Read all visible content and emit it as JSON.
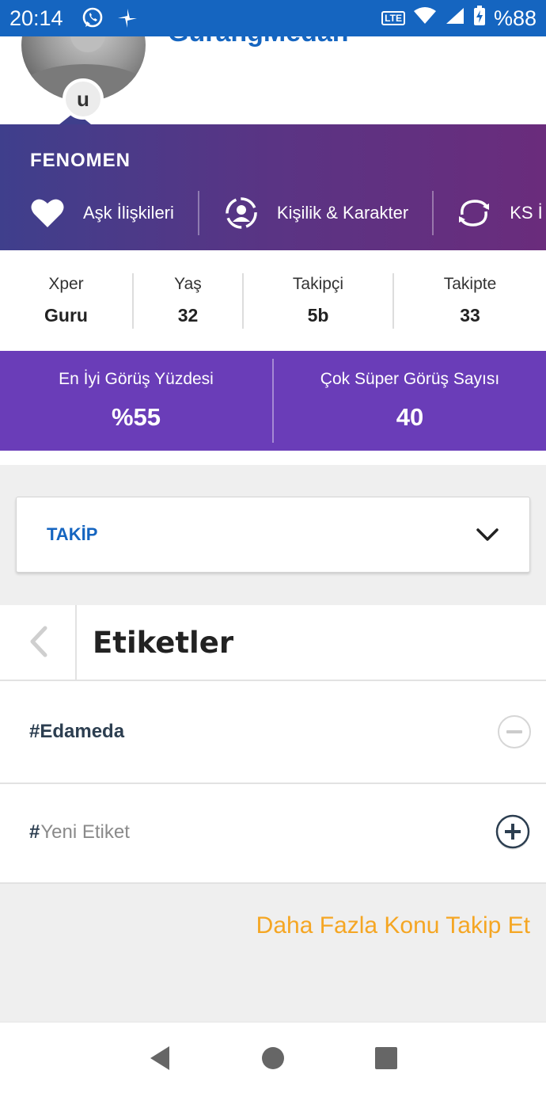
{
  "status_bar": {
    "time": "20:14",
    "left_icons": [
      "whatsapp-icon",
      "pinwheel-icon"
    ],
    "right_icons": [
      "volte-icon",
      "wifi-icon",
      "signal-icon",
      "battery-charging-icon"
    ],
    "lte_label": "LTE",
    "battery": "%88"
  },
  "profile": {
    "username": "GurangMedan",
    "badge_letter": "u"
  },
  "fenomen": {
    "title": "FENOMEN",
    "categories": [
      {
        "label": "Aşk İlişkileri",
        "icon": "heart-icon"
      },
      {
        "label": "Kişilik & Karakter",
        "icon": "person-circle-icon"
      },
      {
        "label": "KS İ",
        "icon": "refresh-icon"
      }
    ]
  },
  "stats": [
    {
      "label": "Xper",
      "value": "Guru"
    },
    {
      "label": "Yaş",
      "value": "32"
    },
    {
      "label": "Takipçi",
      "value": "5b"
    },
    {
      "label": "Takipte",
      "value": "33"
    }
  ],
  "purple_stats": [
    {
      "label": "En İyi Görüş Yüzdesi",
      "value": "%55"
    },
    {
      "label": "Çok Süper Görüş Sayısı",
      "value": "40"
    }
  ],
  "dropdown": {
    "selected": "TAKİP"
  },
  "tags": {
    "title": "Etiketler",
    "items": [
      {
        "name": "#Edameda"
      }
    ],
    "new_tag_hash": "#",
    "new_tag_placeholder": "Yeni Etiket"
  },
  "more_link": "Daha Fazla Konu Takip Et",
  "colors": {
    "primary_blue": "#1565c0",
    "banner_purple": "#6a3db8",
    "link_orange": "#f5a623"
  }
}
